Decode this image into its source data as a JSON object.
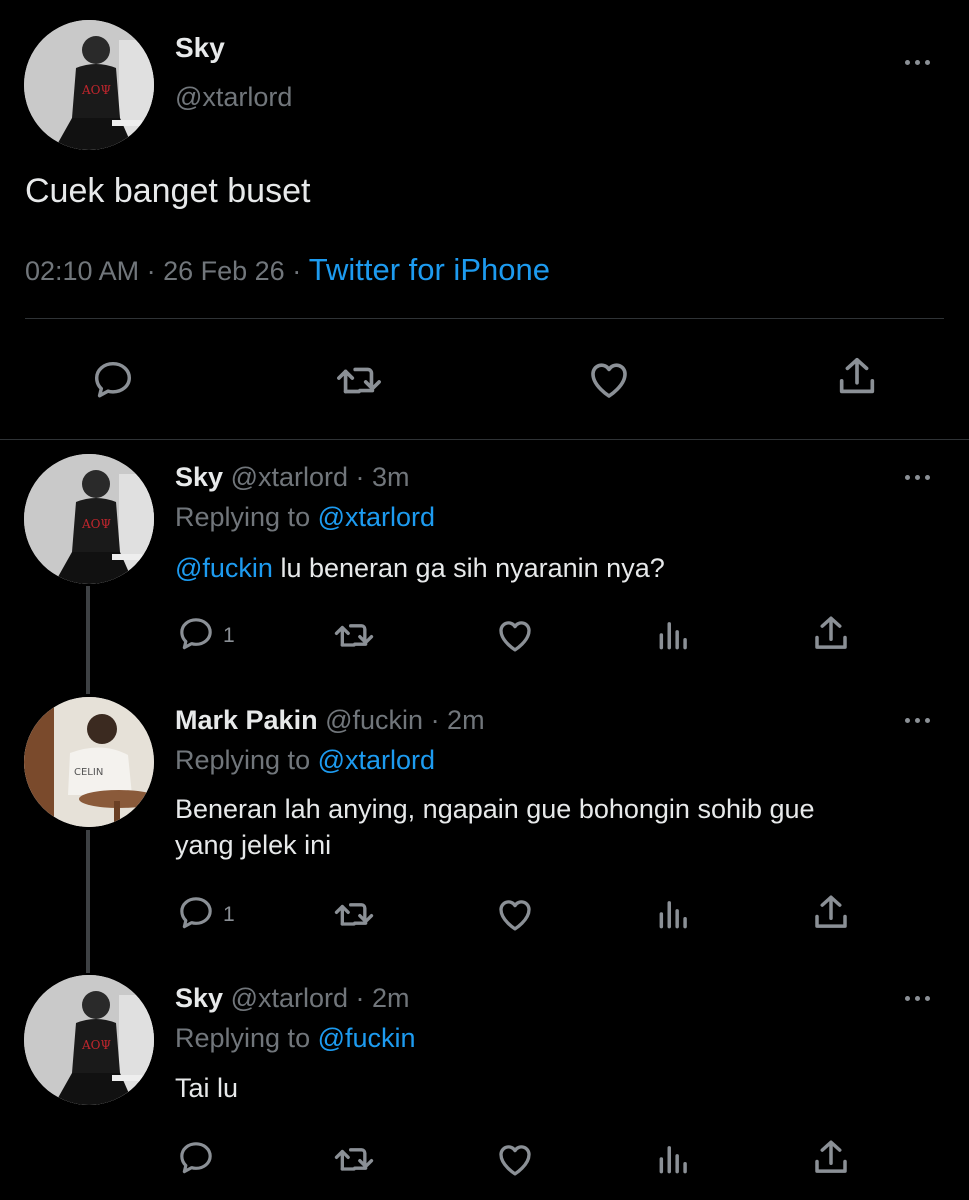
{
  "main_tweet": {
    "display_name": "Sky",
    "handle": "@xtarlord",
    "text": "Cuek banget buset",
    "time": "02:10 AM",
    "date": "26 Feb 26",
    "separator": "·",
    "source": "Twitter for iPhone",
    "actions": [
      "reply-icon",
      "retweet-icon",
      "like-icon",
      "share-icon"
    ]
  },
  "replies": [
    {
      "display_name": "Sky",
      "handle": "@xtarlord",
      "age": "· 3m",
      "replying_prefix": "Replying to",
      "replying_to": "@xtarlord",
      "mention": "@fuckin",
      "text": " lu beneran ga sih nyaranin nya?",
      "reply_count": "1"
    },
    {
      "display_name": "Mark Pakin",
      "handle": "@fuckin",
      "age": "· 2m",
      "replying_prefix": "Replying to",
      "replying_to": "@xtarlord",
      "text_line1": "Beneran lah anying, ngapain gue bohongin sohib gue",
      "text_line2": "yang jelek ini",
      "reply_count": "1"
    },
    {
      "display_name": "Sky",
      "handle": "@xtarlord",
      "age": "· 2m",
      "replying_prefix": "Replying to",
      "replying_to": "@fuckin",
      "text": "Tai lu"
    }
  ],
  "colors": {
    "background": "#000000",
    "text": "#e7e9ea",
    "muted": "#71767b",
    "link": "#1d9bf0",
    "divider": "#2f3336"
  }
}
